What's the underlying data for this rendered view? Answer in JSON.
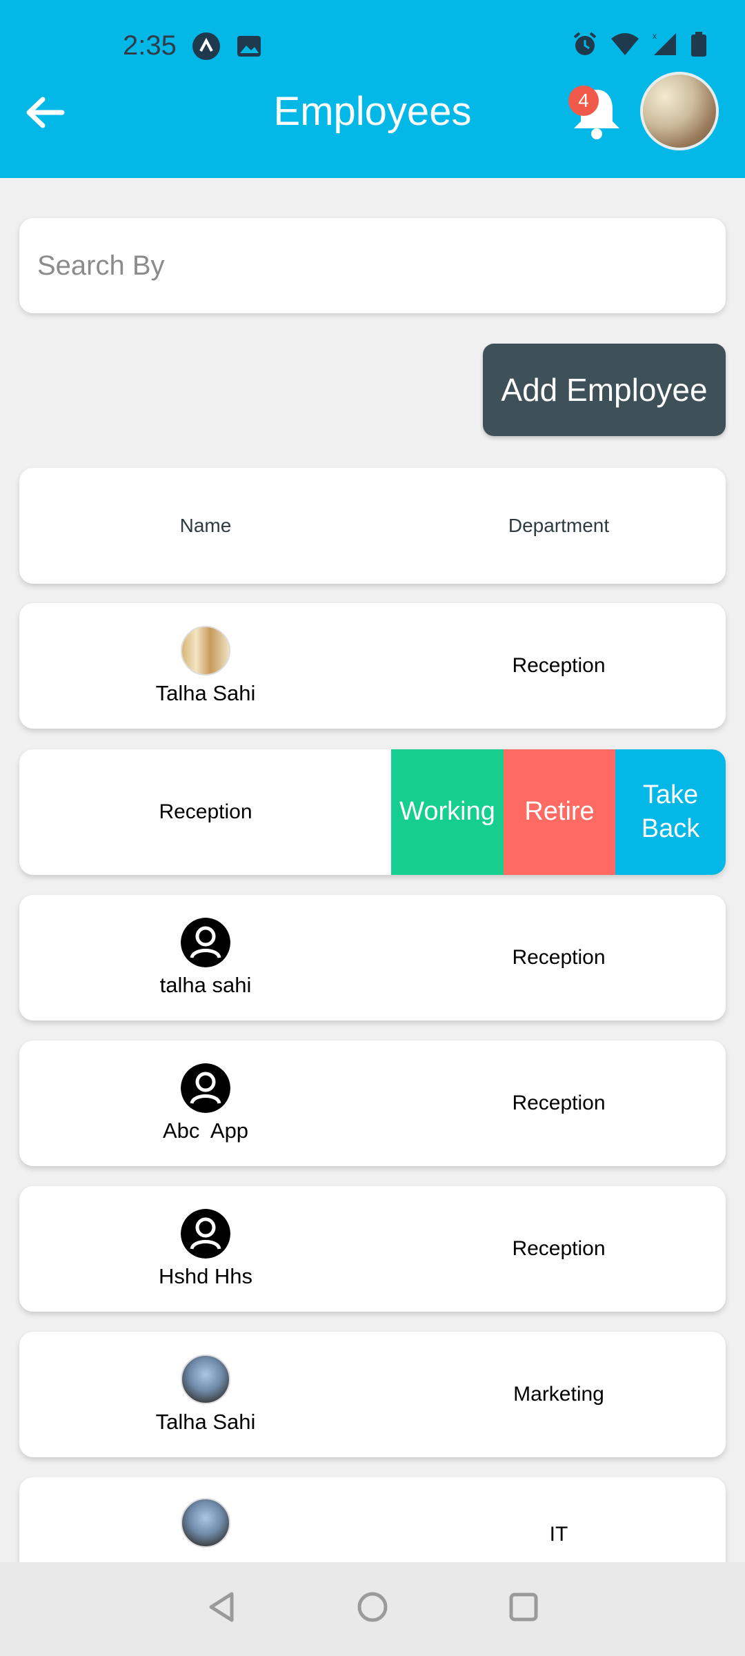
{
  "status": {
    "time": "2:35",
    "icons": [
      "app-icon",
      "image-icon",
      "alarm-icon",
      "wifi-icon",
      "signal-icon",
      "battery-icon"
    ]
  },
  "header": {
    "title": "Employees",
    "back_icon": "arrow-left-icon",
    "notification_count": "4"
  },
  "search": {
    "placeholder": "Search By",
    "value": ""
  },
  "actions": {
    "add_employee": "Add Employee"
  },
  "table": {
    "headers": {
      "name": "Name",
      "department": "Department"
    },
    "rows": [
      {
        "name": "Talha Sahi",
        "department": "Reception",
        "avatar": "photo"
      },
      {
        "name": "",
        "department": "Reception",
        "avatar": "none"
      },
      {
        "name": "talha sahi",
        "department": "Reception",
        "avatar": "person-icon"
      },
      {
        "name": "Abc  App",
        "department": "Reception",
        "avatar": "person-icon"
      },
      {
        "name": "Hshd Hhs",
        "department": "Reception",
        "avatar": "person-icon"
      },
      {
        "name": "Talha Sahi",
        "department": "Marketing",
        "avatar": "photo"
      },
      {
        "name": "",
        "department": "IT",
        "avatar": "photo"
      }
    ],
    "swipe_actions": {
      "working": "Working",
      "retire": "Retire",
      "take_back_line1": "Take",
      "take_back_line2": "Back"
    }
  },
  "colors": {
    "primary": "#03b7e6",
    "working": "#16cf8e",
    "retire": "#ff6b63",
    "add_button": "#3f5158"
  }
}
